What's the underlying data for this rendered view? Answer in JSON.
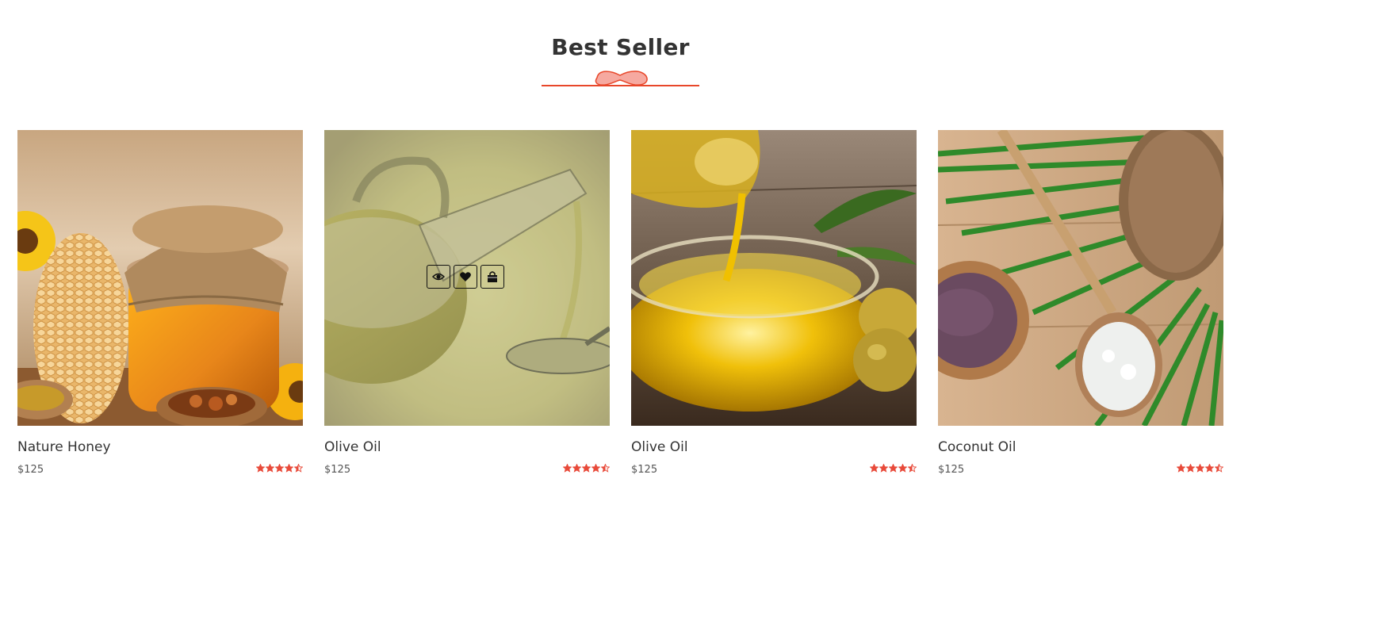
{
  "section": {
    "title": "Best Seller"
  },
  "colors": {
    "accent": "#e8472a",
    "star": "#e84a3a",
    "divider_fill": "#f6a9a0"
  },
  "products": [
    {
      "name": "Nature Honey",
      "price": "$125",
      "rating": 4.5,
      "image": "honey-jar-photo",
      "hover": false
    },
    {
      "name": "Olive Oil",
      "price": "$125",
      "rating": 4.5,
      "image": "olive-oil-bottle-photo",
      "hover": true,
      "actions": [
        "eye-icon",
        "heart-icon",
        "shopping-bag-icon"
      ]
    },
    {
      "name": "Olive Oil",
      "price": "$125",
      "rating": 4.5,
      "image": "olive-oil-bowl-photo",
      "hover": false
    },
    {
      "name": "Coconut Oil",
      "price": "$125",
      "rating": 4.5,
      "image": "coconut-oil-photo",
      "hover": false
    }
  ]
}
